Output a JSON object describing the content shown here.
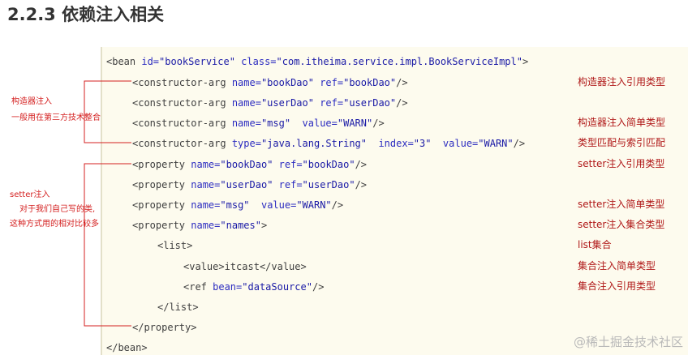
{
  "heading": "2.2.3 依赖注入相关",
  "code": {
    "bean_open": {
      "tag": "<bean",
      "id_attr": " id=",
      "id_val": "\"bookService\"",
      "class_attr": " class=",
      "class_val": "\"com.itheima.service.impl.BookServiceImpl\"",
      "close": ">"
    },
    "ca1": {
      "tag": "<constructor-arg",
      "a1": " name=",
      "v1": "\"bookDao\"",
      "a2": " ref=",
      "v2": "\"bookDao\"",
      "close": "/>"
    },
    "ca2": {
      "tag": "<constructor-arg",
      "a1": " name=",
      "v1": "\"userDao\"",
      "a2": " ref=",
      "v2": "\"userDao\"",
      "close": "/>"
    },
    "ca3": {
      "tag": "<constructor-arg",
      "a1": " name=",
      "v1": "\"msg\"",
      "a2": "  value=",
      "v2": "\"WARN\"",
      "close": "/>"
    },
    "ca4": {
      "tag": "<constructor-arg",
      "a1": " type=",
      "v1": "\"java.lang.String\"",
      "a2": "  index=",
      "v2": "\"3\"",
      "a3": "  value=",
      "v3": "\"WARN\"",
      "close": "/>"
    },
    "p1": {
      "tag": "<property",
      "a1": " name=",
      "v1": "\"bookDao\"",
      "a2": " ref=",
      "v2": "\"bookDao\"",
      "close": "/>"
    },
    "p2": {
      "tag": "<property",
      "a1": " name=",
      "v1": "\"userDao\"",
      "a2": " ref=",
      "v2": "\"userDao\"",
      "close": "/>"
    },
    "p3": {
      "tag": "<property",
      "a1": " name=",
      "v1": "\"msg\"",
      "a2": "  value=",
      "v2": "\"WARN\"",
      "close": "/>"
    },
    "p4": {
      "tag": "<property",
      "a1": " name=",
      "v1": "\"names\"",
      "close": ">"
    },
    "list_open": "<list>",
    "value_line": {
      "open": "<value>",
      "text": "itcast",
      "close": "</value>"
    },
    "ref_line": {
      "tag": "<ref",
      "a1": " bean=",
      "v1": "\"dataSource\"",
      "close": "/>"
    },
    "list_close": "</list>",
    "property_close": "</property>",
    "bean_close": "</bean>"
  },
  "notes": {
    "n1": "构造器注入引用类型",
    "n2": "构造器注入简单类型",
    "n3": "类型匹配与索引匹配",
    "n4": "setter注入引用类型",
    "n5": "setter注入简单类型",
    "n6": "setter注入集合类型",
    "n7": "list集合",
    "n8": "集合注入简单类型",
    "n9": "集合注入引用类型"
  },
  "left_notes": {
    "constructor_title": "构造器注入",
    "constructor_desc": "一般用在第三方技术整合",
    "setter_title": "setter注入",
    "setter_desc1": "对于我们自己写的类,",
    "setter_desc2": "这种方式用的相对比较多"
  },
  "watermark": "@稀土掘金技术社区",
  "colors": {
    "annotation": "#b01818",
    "code_bg": "#fdfbee",
    "bracket": "#d42020"
  }
}
